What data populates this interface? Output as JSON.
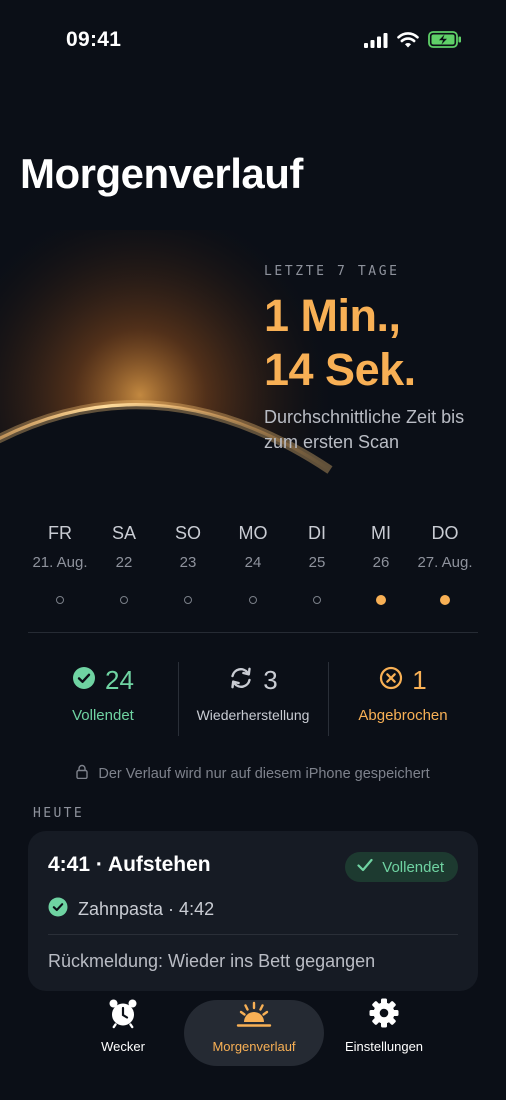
{
  "status_bar": {
    "time": "09:41"
  },
  "page": {
    "title": "Morgenverlauf"
  },
  "stats": {
    "caption": "LETZTE 7 TAGE",
    "value_line1": "1 Min.,",
    "value_line2": "14 Sek.",
    "description": "Durchschnittliche Zeit bis zum ersten Scan"
  },
  "week": [
    {
      "day": "FR",
      "date": "21. Aug.",
      "active": false
    },
    {
      "day": "SA",
      "date": "22",
      "active": false
    },
    {
      "day": "SO",
      "date": "23",
      "active": false
    },
    {
      "day": "MO",
      "date": "24",
      "active": false
    },
    {
      "day": "DI",
      "date": "25",
      "active": false
    },
    {
      "day": "MI",
      "date": "26",
      "active": true
    },
    {
      "day": "DO",
      "date": "27. Aug.",
      "active": true
    }
  ],
  "summary": {
    "completed": {
      "count": "24",
      "label": "Vollendet",
      "color": "#6fd3a2",
      "icon": "check-circle-icon"
    },
    "recovery": {
      "count": "3",
      "label": "Wiederherstellung",
      "color": "#c9ccd3",
      "icon": "refresh-icon"
    },
    "aborted": {
      "count": "1",
      "label": "Abgebrochen",
      "color": "#f8b055",
      "icon": "x-circle-icon"
    }
  },
  "privacy_note": "Der Verlauf wird nur auf diesem iPhone gespeichert",
  "today": {
    "section_label": "HEUTE",
    "title": "4:41 · Aufstehen",
    "badge": "Vollendet",
    "task": "Zahnpasta · 4:42",
    "feedback": "Rückmeldung: Wieder ins Bett gegangen"
  },
  "tabs": [
    {
      "label": "Wecker",
      "icon": "alarm-clock-icon",
      "active": false
    },
    {
      "label": "Morgenverlauf",
      "icon": "sunrise-icon",
      "active": true
    },
    {
      "label": "Einstellungen",
      "icon": "gear-icon",
      "active": false
    }
  ],
  "colors": {
    "accent": "#f8b055",
    "success": "#6fd3a2",
    "background": "#0b0f17"
  }
}
